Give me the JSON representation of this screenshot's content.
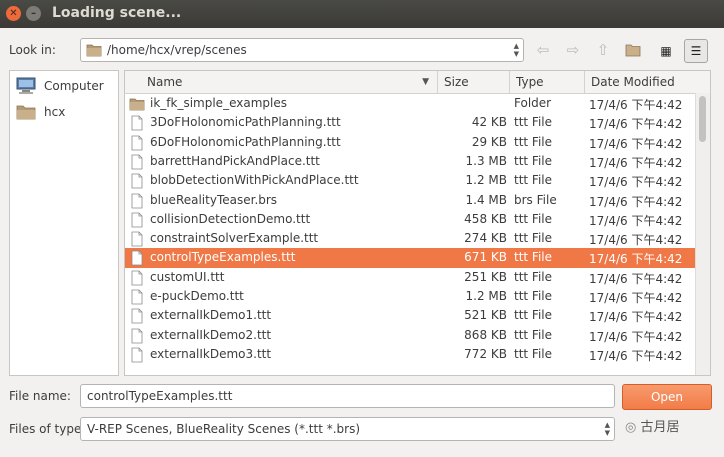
{
  "window": {
    "title": "Loading scene..."
  },
  "lookin": {
    "label": "Look in:",
    "path": "/home/hcx/vrep/scenes"
  },
  "places": [
    {
      "label": "Computer",
      "icon": "computer-icon"
    },
    {
      "label": "hcx",
      "icon": "folder-icon"
    }
  ],
  "columns": {
    "name": "Name",
    "size": "Size",
    "type": "Type",
    "date": "Date Modified"
  },
  "files": [
    {
      "name": "ik_fk_simple_examples",
      "size": "",
      "type": "Folder",
      "date": "17/4/6 下午4:42",
      "kind": "folder"
    },
    {
      "name": "3DoFHolonomicPathPlanning.ttt",
      "size": "42 KB",
      "type": "ttt File",
      "date": "17/4/6 下午4:42",
      "kind": "file"
    },
    {
      "name": "6DoFHolonomicPathPlanning.ttt",
      "size": "29 KB",
      "type": "ttt File",
      "date": "17/4/6 下午4:42",
      "kind": "file"
    },
    {
      "name": "barrettHandPickAndPlace.ttt",
      "size": "1.3 MB",
      "type": "ttt File",
      "date": "17/4/6 下午4:42",
      "kind": "file"
    },
    {
      "name": "blobDetectionWithPickAndPlace.ttt",
      "size": "1.2 MB",
      "type": "ttt File",
      "date": "17/4/6 下午4:42",
      "kind": "file"
    },
    {
      "name": "blueRealityTeaser.brs",
      "size": "1.4 MB",
      "type": "brs File",
      "date": "17/4/6 下午4:42",
      "kind": "file"
    },
    {
      "name": "collisionDetectionDemo.ttt",
      "size": "458 KB",
      "type": "ttt File",
      "date": "17/4/6 下午4:42",
      "kind": "file"
    },
    {
      "name": "constraintSolverExample.ttt",
      "size": "274 KB",
      "type": "ttt File",
      "date": "17/4/6 下午4:42",
      "kind": "file"
    },
    {
      "name": "controlTypeExamples.ttt",
      "size": "671 KB",
      "type": "ttt File",
      "date": "17/4/6 下午4:42",
      "kind": "file",
      "selected": true
    },
    {
      "name": "customUI.ttt",
      "size": "251 KB",
      "type": "ttt File",
      "date": "17/4/6 下午4:42",
      "kind": "file"
    },
    {
      "name": "e-puckDemo.ttt",
      "size": "1.2 MB",
      "type": "ttt File",
      "date": "17/4/6 下午4:42",
      "kind": "file"
    },
    {
      "name": "externalIkDemo1.ttt",
      "size": "521 KB",
      "type": "ttt File",
      "date": "17/4/6 下午4:42",
      "kind": "file"
    },
    {
      "name": "externalIkDemo2.ttt",
      "size": "868 KB",
      "type": "ttt File",
      "date": "17/4/6 下午4:42",
      "kind": "file"
    },
    {
      "name": "externalIkDemo3.ttt",
      "size": "772 KB",
      "type": "ttt File",
      "date": "17/4/6 下午4:42",
      "kind": "file"
    }
  ],
  "filename": {
    "label": "File name:",
    "value": "controlTypeExamples.ttt"
  },
  "open_button": "Open",
  "filetype": {
    "label": "Files of type:",
    "value": "V-REP Scenes, BlueReality Scenes (*.ttt *.brs)"
  },
  "watermark": "古月居",
  "colors": {
    "accent": "#f07746",
    "titlebar": "#3b3a36"
  }
}
